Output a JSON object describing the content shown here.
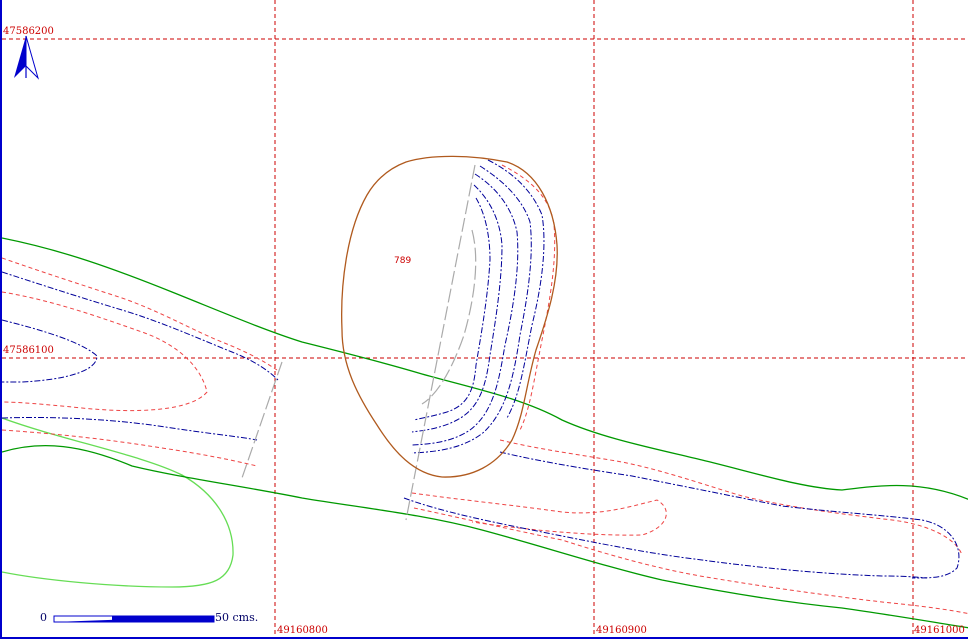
{
  "map": {
    "parcel_number": "789",
    "grid": {
      "line_color": "#cc0000",
      "y_labels": [
        "47586200",
        "47586100"
      ],
      "x_labels": [
        "49160800",
        "49160900",
        "49161000"
      ]
    },
    "north_arrow_icon": "north-arrow-icon",
    "scale_bar": {
      "start_label": "0",
      "end_label": "50 cms."
    },
    "colors": {
      "road_edges": "#009900",
      "light_green_area": "#66dd55",
      "parcel_outline": "#b05a1e",
      "contour_red": "#ee4444",
      "contour_blue": "#000099",
      "gray_line": "#aaaaaa",
      "frame": "#0000cc"
    }
  }
}
